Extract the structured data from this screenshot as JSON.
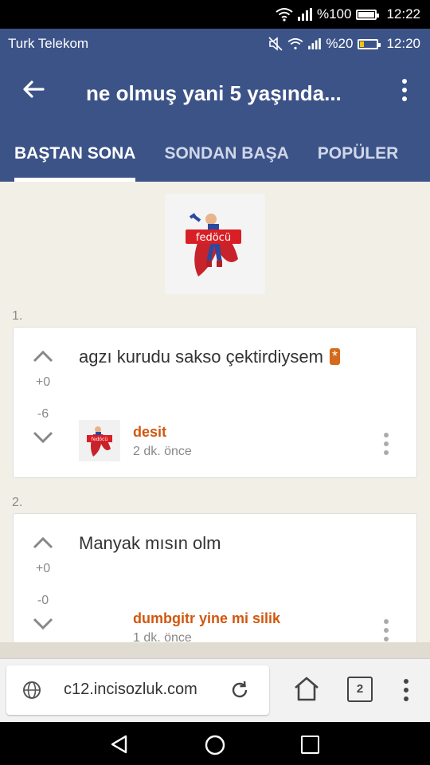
{
  "status_outer": {
    "battery": "%100",
    "time": "12:22",
    "battery_level": 1.0
  },
  "status_inner": {
    "carrier": "Turk Telekom",
    "battery": "%20",
    "time": "12:20",
    "battery_level": 0.2
  },
  "header": {
    "title": "ne olmuş yani 5 yaşında...",
    "tabs": [
      {
        "label": "BAŞTAN SONA",
        "active": true
      },
      {
        "label": "SONDAN BAŞA",
        "active": false
      },
      {
        "label": "POPÜLER",
        "active": false
      }
    ]
  },
  "topic_avatar": {
    "badge_text": "fedöcü"
  },
  "entries": [
    {
      "index": "1.",
      "text": "agzı kurudu sakso çektirdiysem",
      "star": "*",
      "upvotes": "+0",
      "downvotes": "-6",
      "author": "desit",
      "time": "2 dk. önce",
      "avatar_badge": "fedöcü"
    },
    {
      "index": "2.",
      "text": "Manyak mısın olm",
      "upvotes": "+0",
      "downvotes": "-0",
      "author": "dumbgitr yine mi silik",
      "time": "1 dk. önce"
    }
  ],
  "browser": {
    "url": "c12.incisozluk.com",
    "tab_count": "2"
  },
  "colors": {
    "primary": "#3c5388",
    "accent": "#d0580e",
    "background": "#f2efe6"
  }
}
